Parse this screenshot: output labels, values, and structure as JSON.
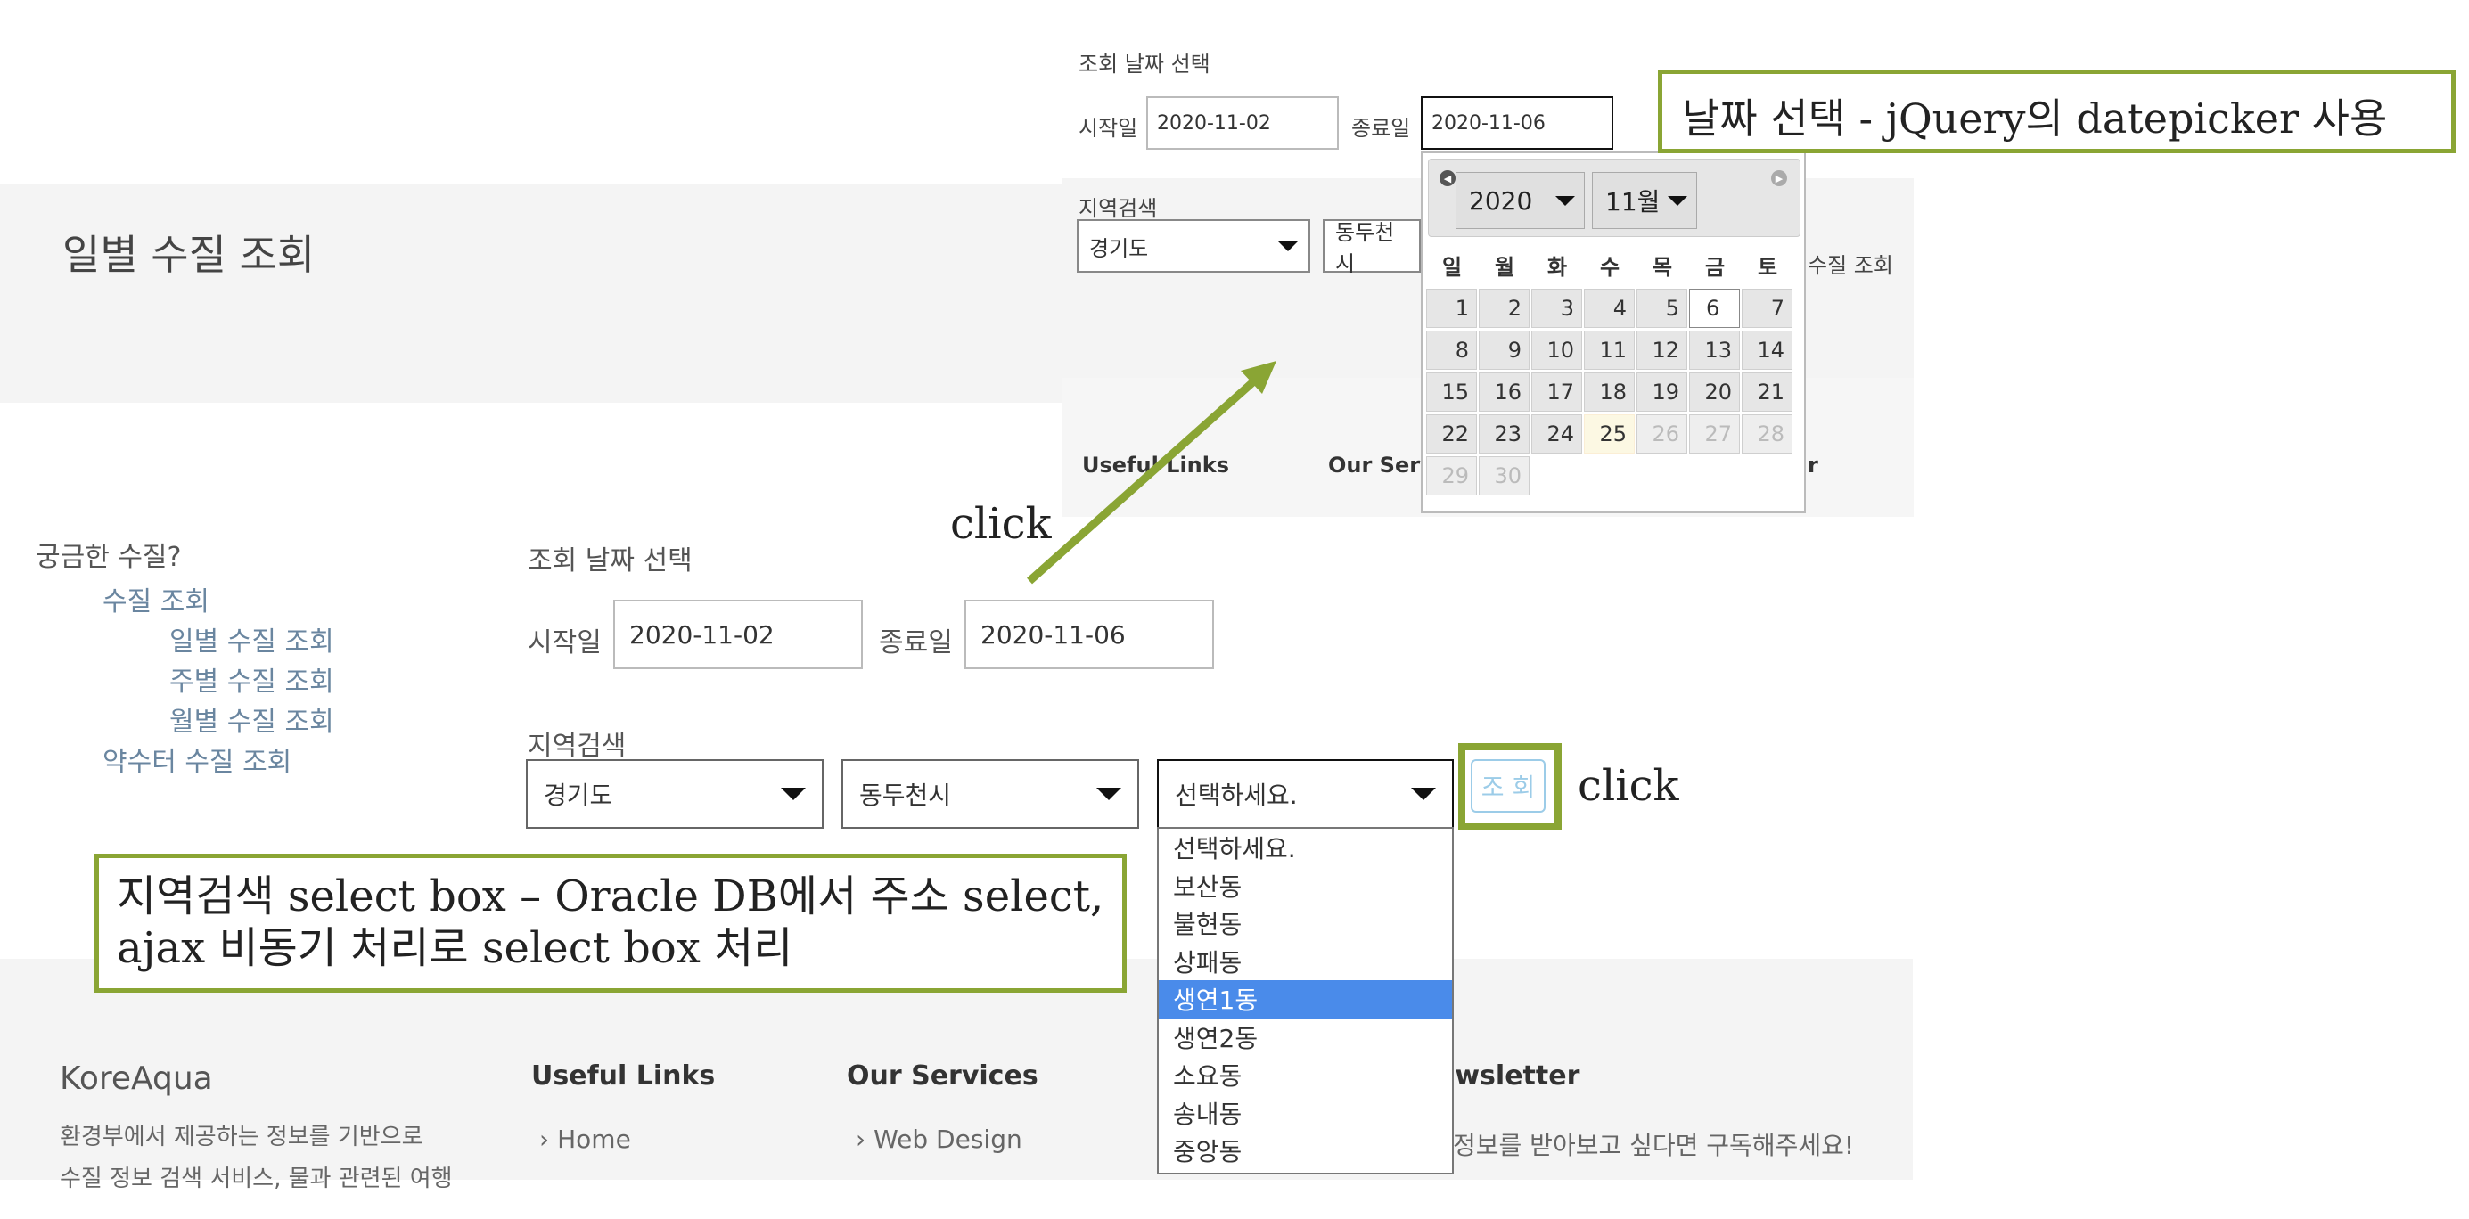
{
  "hero": {
    "title": "일별 수질 조회"
  },
  "sidebar": {
    "title": "궁금한 수질?",
    "items": [
      {
        "label": "수질 조회"
      },
      {
        "label": "일별 수질 조회"
      },
      {
        "label": "주별 수질 조회"
      },
      {
        "label": "월별 수질 조회"
      },
      {
        "label": "약수터 수질 조회"
      }
    ]
  },
  "form": {
    "date_section_label": "조회 날짜 선택",
    "start_label": "시작일",
    "start_value": "2020-11-02",
    "end_label": "종료일",
    "end_value": "2020-11-06",
    "region_label": "지역검색",
    "province": "경기도",
    "city": "동두천시",
    "district": "선택하세요.",
    "search_button": "조 회",
    "district_options": [
      "선택하세요.",
      "보산동",
      "불현동",
      "상패동",
      "생연1동",
      "생연2동",
      "소요동",
      "송내동",
      "중앙동"
    ],
    "highlighted_option": "생연1동"
  },
  "footer": {
    "brand": "KoreAqua",
    "desc_line1": "환경부에서 제공하는 정보를 기반으로",
    "desc_line2": "수질 정보 검색 서비스, 물과 관련된 여행",
    "useful_links_title": "Useful Links",
    "services_title": "Our Services",
    "newsletter_title": "ewsletter",
    "link_home": "Home",
    "link_web_design": "Web Design",
    "newsletter_text": "정보를 받아보고 싶다면 구독해주세요!"
  },
  "overlay": {
    "date_section_label": "조회 날짜 선택",
    "start_label": "시작일",
    "start_value": "2020-11-02",
    "end_label": "종료일",
    "end_value": "2020-11-06",
    "region_label": "지역검색",
    "province": "경기도",
    "city": "동두천시",
    "footer_useful_links": "Useful Links",
    "footer_services": "Our Servi",
    "right_fragment": "수질 조회",
    "footer_tail": "r"
  },
  "datepicker": {
    "year": "2020",
    "month": "11월",
    "weekdays": [
      "일",
      "월",
      "화",
      "수",
      "목",
      "금",
      "토"
    ],
    "weeks": [
      [
        "1",
        "2",
        "3",
        "4",
        "5",
        "6",
        "7"
      ],
      [
        "8",
        "9",
        "10",
        "11",
        "12",
        "13",
        "14"
      ],
      [
        "15",
        "16",
        "17",
        "18",
        "19",
        "20",
        "21"
      ],
      [
        "22",
        "23",
        "24",
        "25",
        "26",
        "27",
        "28"
      ],
      [
        "29",
        "30",
        "",
        "",
        "",
        "",
        ""
      ]
    ],
    "today": "25",
    "selected": "6"
  },
  "annotations": {
    "datepicker_note": "날짜 선택 - jQuery의 datepicker 사용",
    "select_note_line1": "지역검색 select box – Oracle DB에서 주소 select,",
    "select_note_line2": "ajax 비동기 처리로 select box 처리",
    "click_top": "click",
    "click_right": "click",
    "accent_color": "#8aa534"
  }
}
